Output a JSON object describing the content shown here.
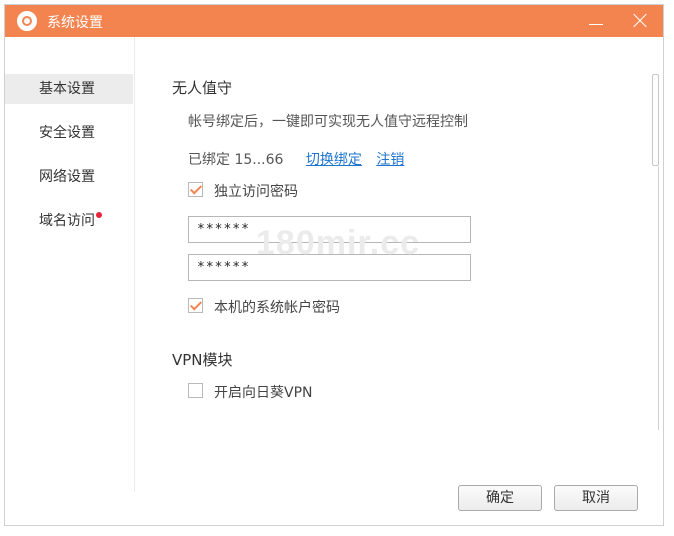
{
  "window": {
    "title": "系统设置"
  },
  "sidebar": {
    "items": [
      {
        "label": "基本设置",
        "active": true
      },
      {
        "label": "安全设置",
        "active": false
      },
      {
        "label": "网络设置",
        "active": false
      },
      {
        "label": "域名访问",
        "active": false,
        "badge": "red-dot"
      }
    ]
  },
  "unattended": {
    "title": "无人值守",
    "description": "帐号绑定后，一键即可实现无人值守远程控制",
    "bound_text": "已绑定 15...66",
    "switch_link": "切换绑定",
    "logout_link": "注销",
    "independent_password": {
      "label": "独立访问密码",
      "checked": true
    },
    "password1": "******",
    "password2": "******",
    "system_password": {
      "label": "本机的系统帐户密码",
      "checked": true
    }
  },
  "vpn": {
    "title": "VPN模块",
    "enable": {
      "label": "开启向日葵VPN",
      "checked": false
    }
  },
  "footer": {
    "ok_label": "确定",
    "cancel_label": "取消"
  },
  "watermark": "180mir.cc",
  "colors": {
    "accent": "#f4844f",
    "link": "#1f75d0",
    "badge": "#e8263a"
  }
}
